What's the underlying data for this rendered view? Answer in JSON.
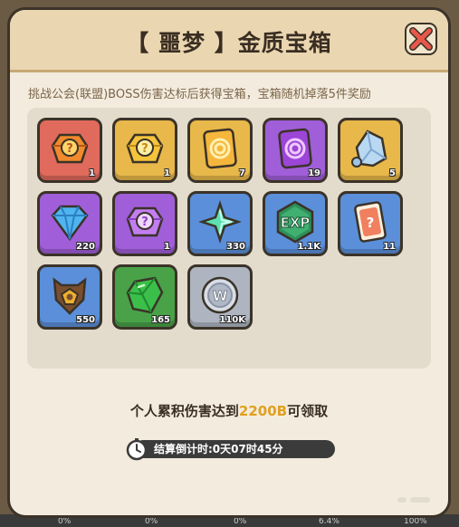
{
  "dialog": {
    "title": "【 噩梦 】金质宝箱",
    "description": "挑战公会(联盟)BOSS伤害达标后获得宝箱，宝箱随机掉落5件奖励",
    "footer_prefix": "个人累积伤害达到",
    "footer_highlight": "2200B",
    "footer_suffix": "可领取",
    "timer_label": "结算倒计时:0天07时45分"
  },
  "rewards": [
    {
      "icon": "orange-mystery-gem-pack",
      "qty": "1",
      "frame": "red"
    },
    {
      "icon": "gold-mystery-gem-pack",
      "qty": "1",
      "frame": "gold"
    },
    {
      "icon": "gold-swirl-card",
      "qty": "7",
      "frame": "gold"
    },
    {
      "icon": "purple-swirl-card",
      "qty": "19",
      "frame": "purple"
    },
    {
      "icon": "ice-crystal",
      "qty": "5",
      "frame": "gold"
    },
    {
      "icon": "blue-diamond",
      "qty": "220",
      "frame": "purple"
    },
    {
      "icon": "purple-mystery-gem-pack",
      "qty": "1",
      "frame": "purple"
    },
    {
      "icon": "green-sparkle-star",
      "qty": "330",
      "frame": "blue"
    },
    {
      "icon": "exp-badge",
      "qty": "1.1K",
      "frame": "blue"
    },
    {
      "icon": "mystery-card",
      "qty": "11",
      "frame": "blue"
    },
    {
      "icon": "horned-shield-emblem",
      "qty": "550",
      "frame": "blue"
    },
    {
      "icon": "green-emerald",
      "qty": "165",
      "frame": "green"
    },
    {
      "icon": "silver-w-coin",
      "qty": "110K",
      "frame": "grey"
    }
  ],
  "background_footer": [
    "0%",
    "0%",
    "0%",
    "6.4%",
    "100%"
  ],
  "colors": {
    "highlight": "#e0a020",
    "panel": "#f3ecde",
    "close": "#e8574a"
  }
}
